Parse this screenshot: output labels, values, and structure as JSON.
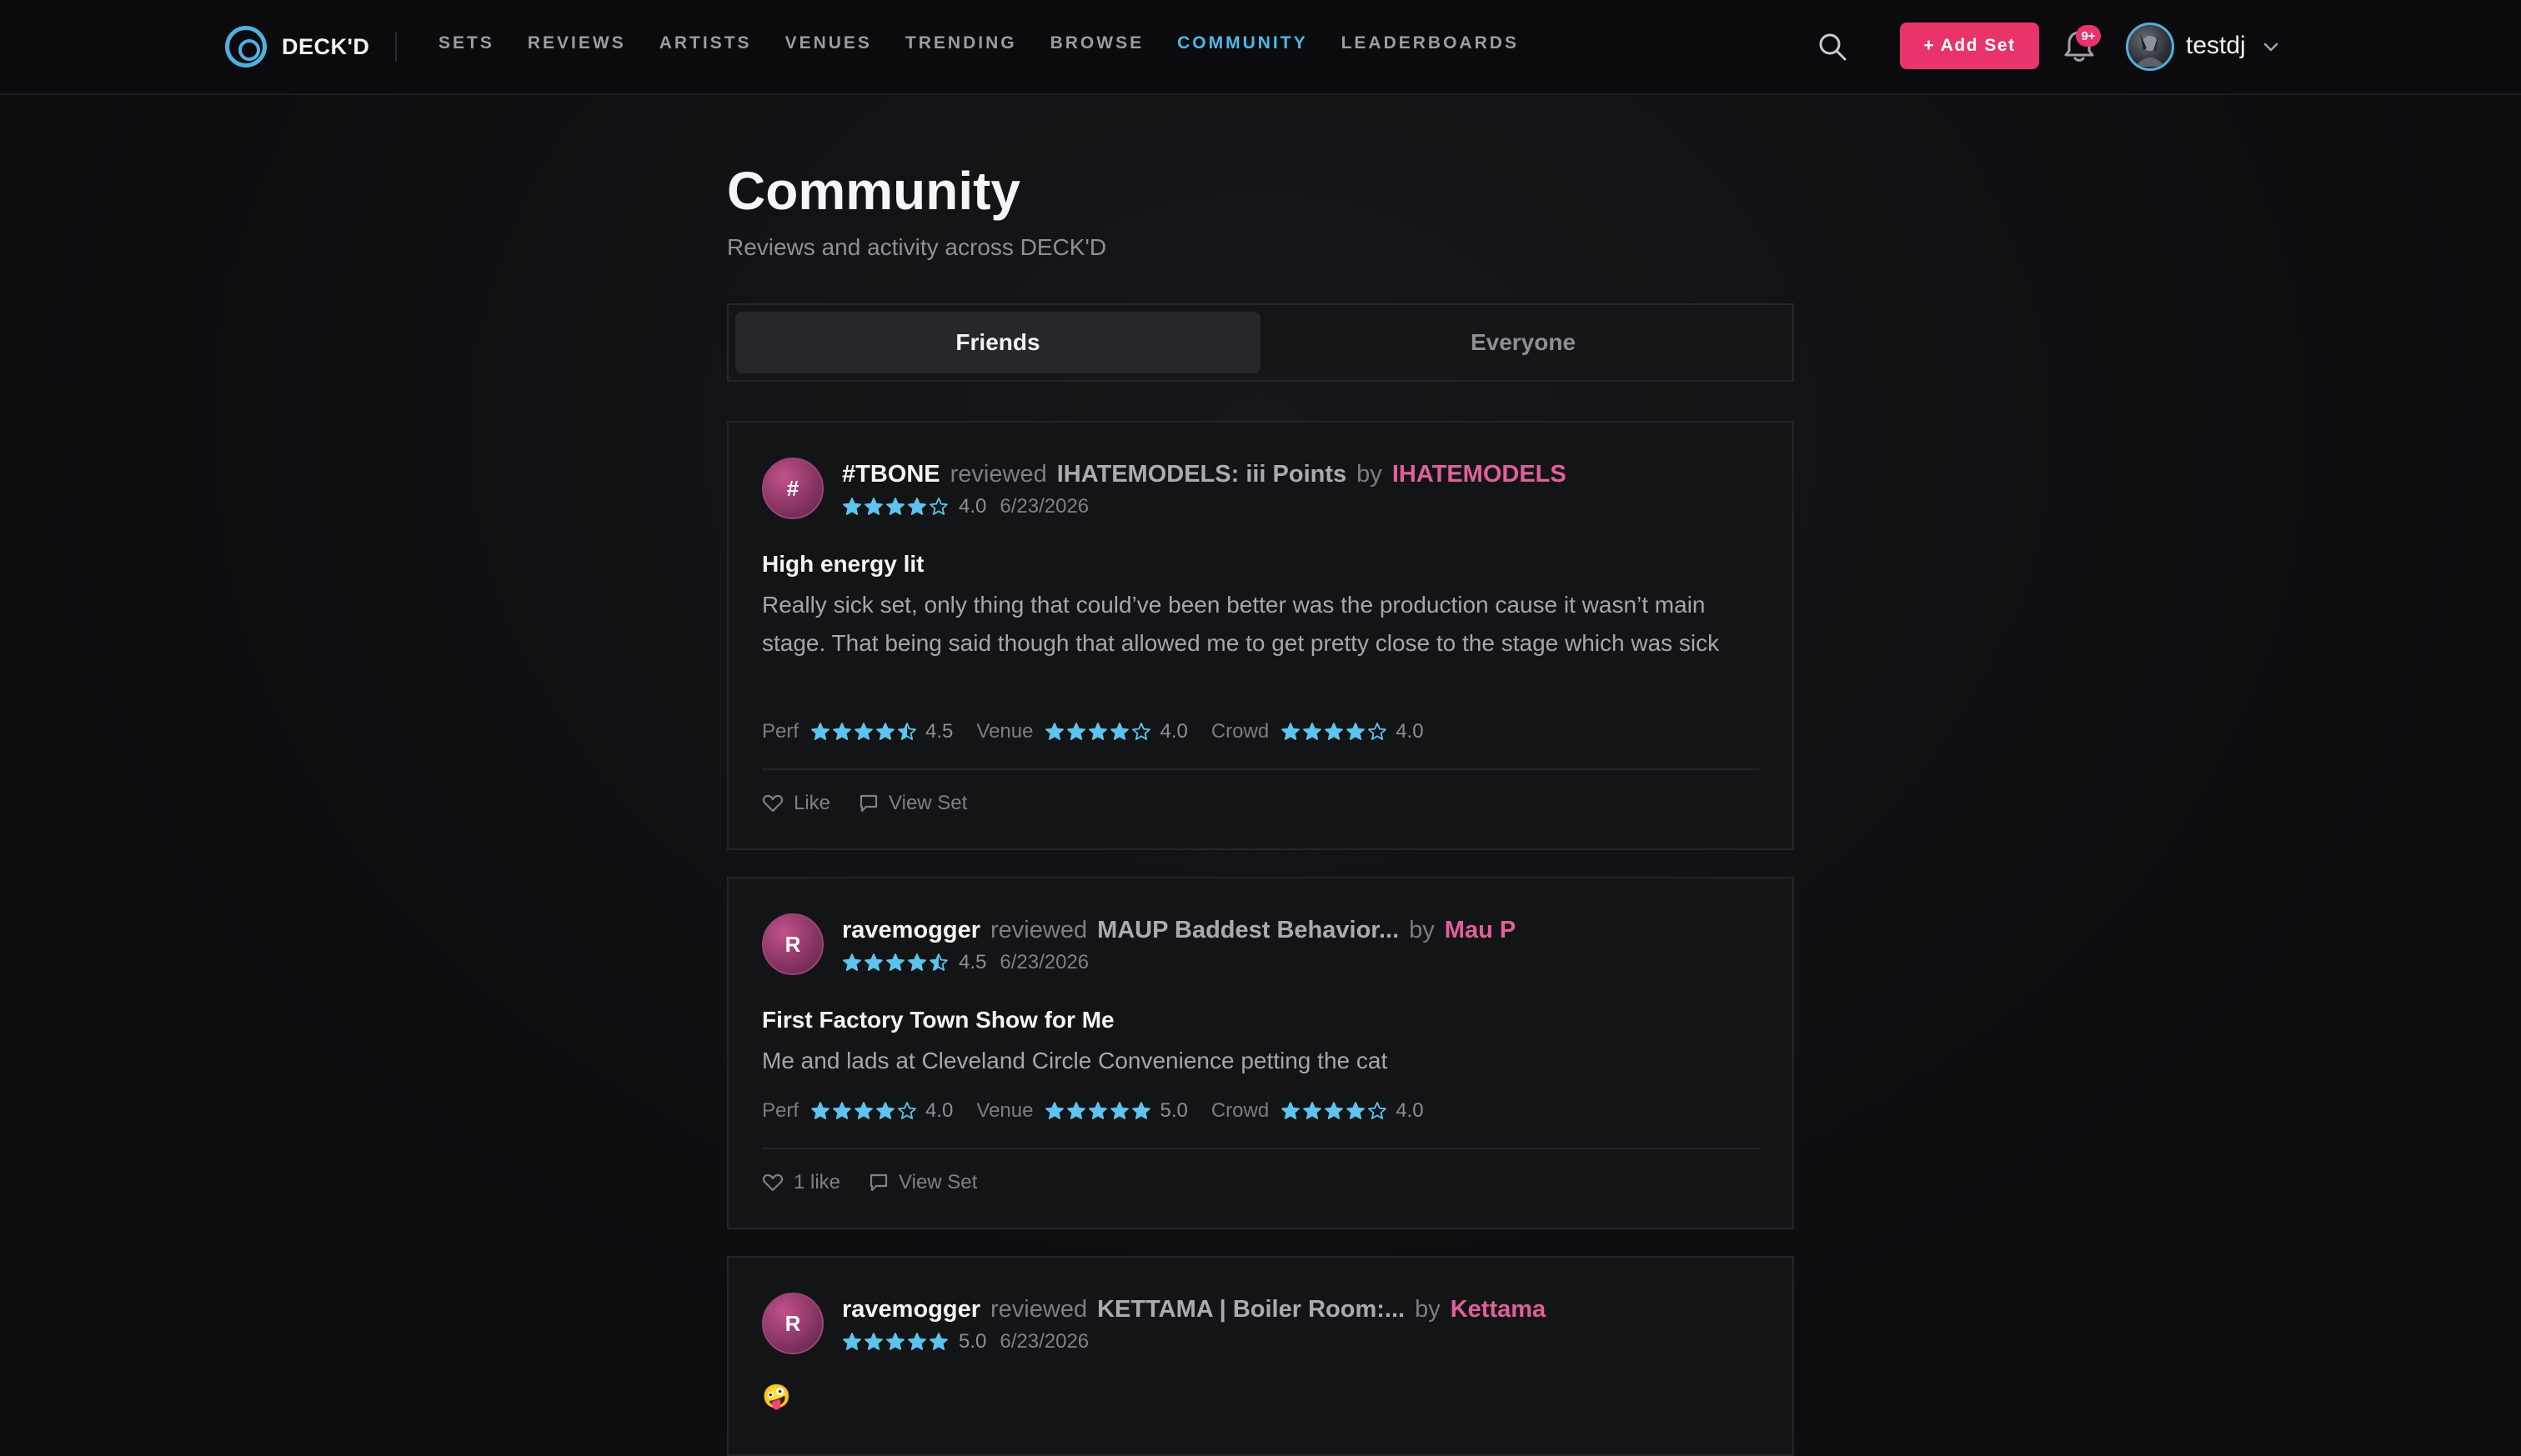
{
  "nav": {
    "logo_text": "DECK'D",
    "links": [
      "SETS",
      "REVIEWS",
      "ARTISTS",
      "VENUES",
      "TRENDING",
      "BROWSE",
      "COMMUNITY",
      "LEADERBOARDS"
    ],
    "active_link": "COMMUNITY",
    "add_set_label": "+ Add Set",
    "notification_badge": "9+",
    "username": "testdj",
    "accent_color": "#4fb8e6",
    "brand_pink": "#e8336b"
  },
  "page": {
    "title": "Community",
    "subtitle": "Reviews and activity across DECK'D"
  },
  "tabs": [
    {
      "label": "Friends",
      "active": true
    },
    {
      "label": "Everyone",
      "active": false
    }
  ],
  "reviews": [
    {
      "avatar_letter": "#",
      "user": "#TBONE",
      "verb": "reviewed",
      "set": "IHATEMODELS: iii Points",
      "by": "by",
      "artist": "IHATEMODELS",
      "rating": "4.0",
      "rating_value": 4.0,
      "date": "6/23/2026",
      "title": "High energy lit",
      "body": "Really sick set, only thing that could’ve been better was the production cause it wasn’t main stage. That being said though that allowed me to get pretty close to the stage which was sick",
      "sub_ratings": [
        {
          "label": "Perf",
          "value": "4.5",
          "stars": 4.5
        },
        {
          "label": "Venue",
          "value": "4.0",
          "stars": 4.0
        },
        {
          "label": "Crowd",
          "value": "4.0",
          "stars": 4.0
        }
      ],
      "like_label": "Like",
      "view_label": "View Set"
    },
    {
      "avatar_letter": "R",
      "user": "ravemogger",
      "verb": "reviewed",
      "set": "MAUP Baddest Behavior...",
      "by": "by",
      "artist": "Mau P",
      "rating": "4.5",
      "rating_value": 4.5,
      "date": "6/23/2026",
      "title": "First Factory Town Show for Me",
      "body": "Me and lads at Cleveland Circle Convenience petting the cat",
      "sub_ratings": [
        {
          "label": "Perf",
          "value": "4.0",
          "stars": 4.0
        },
        {
          "label": "Venue",
          "value": "5.0",
          "stars": 5.0
        },
        {
          "label": "Crowd",
          "value": "4.0",
          "stars": 4.0
        }
      ],
      "like_label": "1 like",
      "view_label": "View Set"
    },
    {
      "avatar_letter": "R",
      "user": "ravemogger",
      "verb": "reviewed",
      "set": "KETTAMA | Boiler Room:...",
      "by": "by",
      "artist": "Kettama",
      "rating": "5.0",
      "rating_value": 5.0,
      "date": "6/23/2026",
      "title": "🤪"
    }
  ]
}
